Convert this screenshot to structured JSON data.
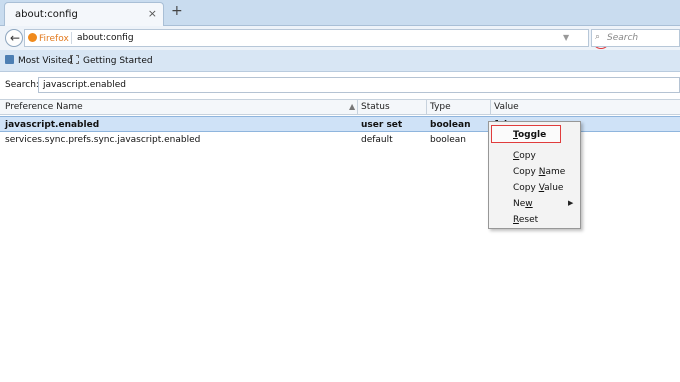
{
  "tab": {
    "title": "about:config",
    "close": "×",
    "new_tab": "+"
  },
  "nav": {
    "back_glyph": "←",
    "identity_label": "Firefox",
    "url": "about:config",
    "dropmarker": "▼",
    "reload_glyph": "↻",
    "search_placeholder": "Search",
    "search_glyph": "⌕"
  },
  "bookmarks": [
    {
      "label": "Most Visited"
    },
    {
      "label": "Getting Started"
    }
  ],
  "filter": {
    "label": "Search:",
    "value": "javascript.enabled"
  },
  "table": {
    "headers": [
      "Preference Name",
      "Status",
      "Type",
      "Value"
    ],
    "sort_glyph": "▲",
    "rows": [
      {
        "name": "javascript.enabled",
        "status": "user set",
        "type": "boolean",
        "value": "false",
        "selected": true
      },
      {
        "name": "services.sync.prefs.sync.javascript.enabled",
        "status": "default",
        "type": "boolean",
        "value": "",
        "selected": false
      }
    ]
  },
  "context_menu": {
    "items": [
      {
        "pre": "",
        "u": "T",
        "post": "oggle"
      },
      {
        "pre": "",
        "u": "C",
        "post": "opy"
      },
      {
        "pre": "Copy ",
        "u": "N",
        "post": "ame"
      },
      {
        "pre": "Copy ",
        "u": "V",
        "post": "alue"
      },
      {
        "pre": "Ne",
        "u": "w",
        "post": ""
      },
      {
        "pre": "",
        "u": "R",
        "post": "eset"
      }
    ],
    "submenu_glyph": "▶"
  },
  "colors": {
    "highlight_ring": "#e03c3c",
    "selection": "#cfe2f7",
    "firefox_orange": "#e27a1f"
  }
}
